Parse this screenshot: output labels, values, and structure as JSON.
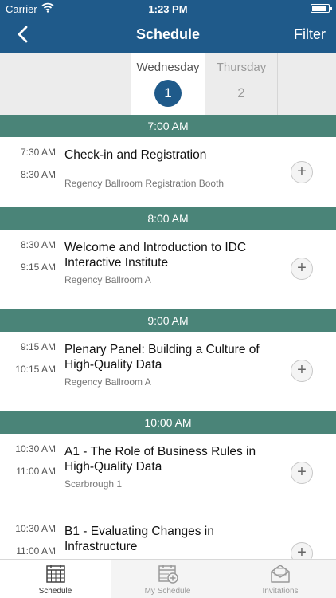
{
  "status_bar": {
    "carrier": "Carrier",
    "time": "1:23 PM"
  },
  "nav": {
    "title": "Schedule",
    "filter_label": "Filter"
  },
  "days": [
    {
      "name": "Wednesday",
      "number": "1"
    },
    {
      "name": "Thursday",
      "number": "2"
    }
  ],
  "sections": [
    {
      "header": "7:00 AM",
      "items": [
        {
          "start": "7:30 AM",
          "end": "8:30 AM",
          "title": "Check-in and Registration",
          "location": "Regency Ballroom Registration Booth"
        }
      ]
    },
    {
      "header": "8:00 AM",
      "items": [
        {
          "start": "8:30 AM",
          "end": "9:15 AM",
          "title": "Welcome and Introduction to IDC Interactive Institute",
          "location": "Regency Ballroom A"
        }
      ]
    },
    {
      "header": "9:00 AM",
      "items": [
        {
          "start": "9:15 AM",
          "end": "10:15 AM",
          "title": "Plenary Panel: Building a Culture of High-Quality Data",
          "location": "Regency Ballroom A"
        }
      ]
    },
    {
      "header": "10:00 AM",
      "items": [
        {
          "start": "10:30 AM",
          "end": "11:00 AM",
          "title": "A1 - The Role of Business Rules in High-Quality Data",
          "location": "Scarbrough 1"
        },
        {
          "start": "10:30 AM",
          "end": "11:00 AM",
          "title": "B1 - Evaluating Changes in Infrastructure",
          "location": ""
        }
      ]
    }
  ],
  "add_symbol": "+",
  "tabs": [
    {
      "label": "Schedule",
      "icon": "calendar-icon"
    },
    {
      "label": "My Schedule",
      "icon": "calendar-add-icon"
    },
    {
      "label": "Invitations",
      "icon": "envelope-icon"
    }
  ],
  "colors": {
    "nav": "#1f5a8a",
    "section_header": "#4a8478"
  }
}
